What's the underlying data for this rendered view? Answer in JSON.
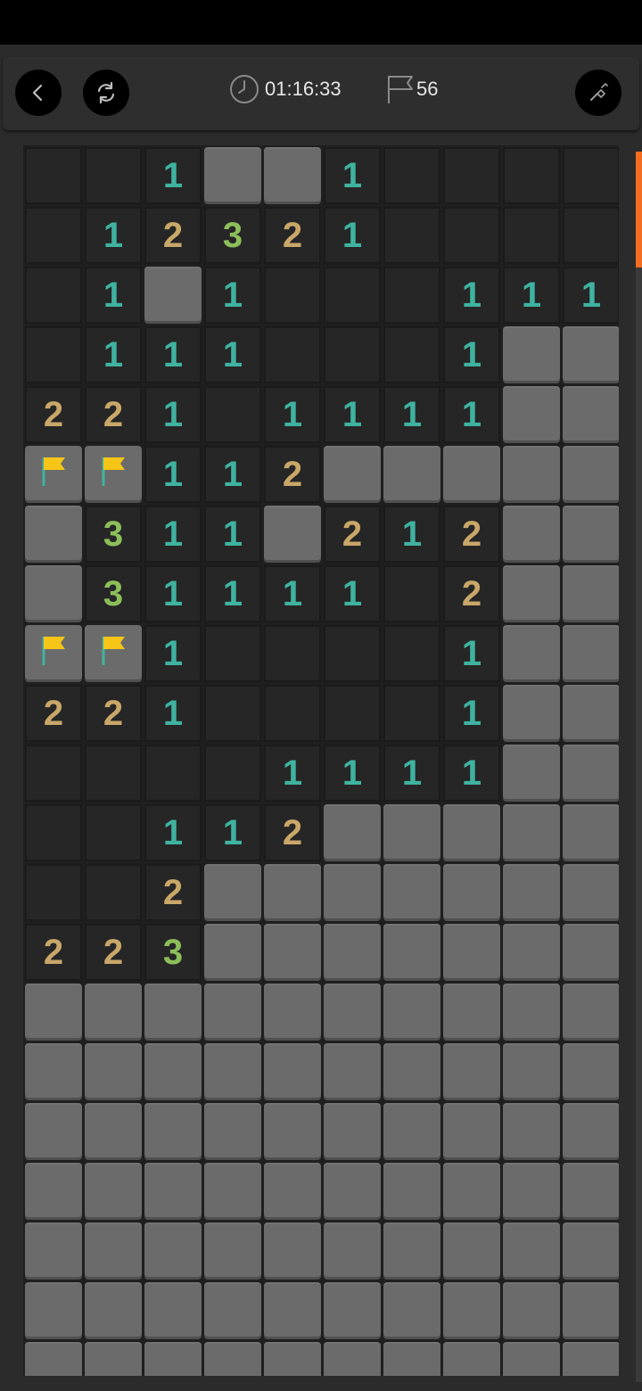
{
  "toolbar": {
    "timer": "01:16:33",
    "flags": "56",
    "icons": {
      "back": "back-chevron-icon",
      "restart": "restart-icon",
      "clock": "clock-icon",
      "flag": "flag-icon",
      "shovel": "shovel-icon"
    }
  },
  "colors": {
    "accent": "#f26d21",
    "one": "#3fb3a0",
    "two": "#c9a769",
    "three": "#8cbf5a",
    "flag": "#f5c518"
  },
  "board": {
    "columns": 10,
    "legend": "# = closed, . = open empty, F = flag, digit = open number",
    "rows": [
      "..1##1....",
      ".12321....",
      ".1#1...111",
      ".111...1##",
      "221.1111##",
      "FF112#####",
      "#311#212##",
      "#31111.2##",
      "FF1....1##",
      "221....1##",
      "....1111##",
      "..112#####",
      "..2#######",
      "223#######",
      "##########",
      "##########",
      "##########",
      "##########",
      "##########",
      "##########",
      "##########"
    ]
  }
}
